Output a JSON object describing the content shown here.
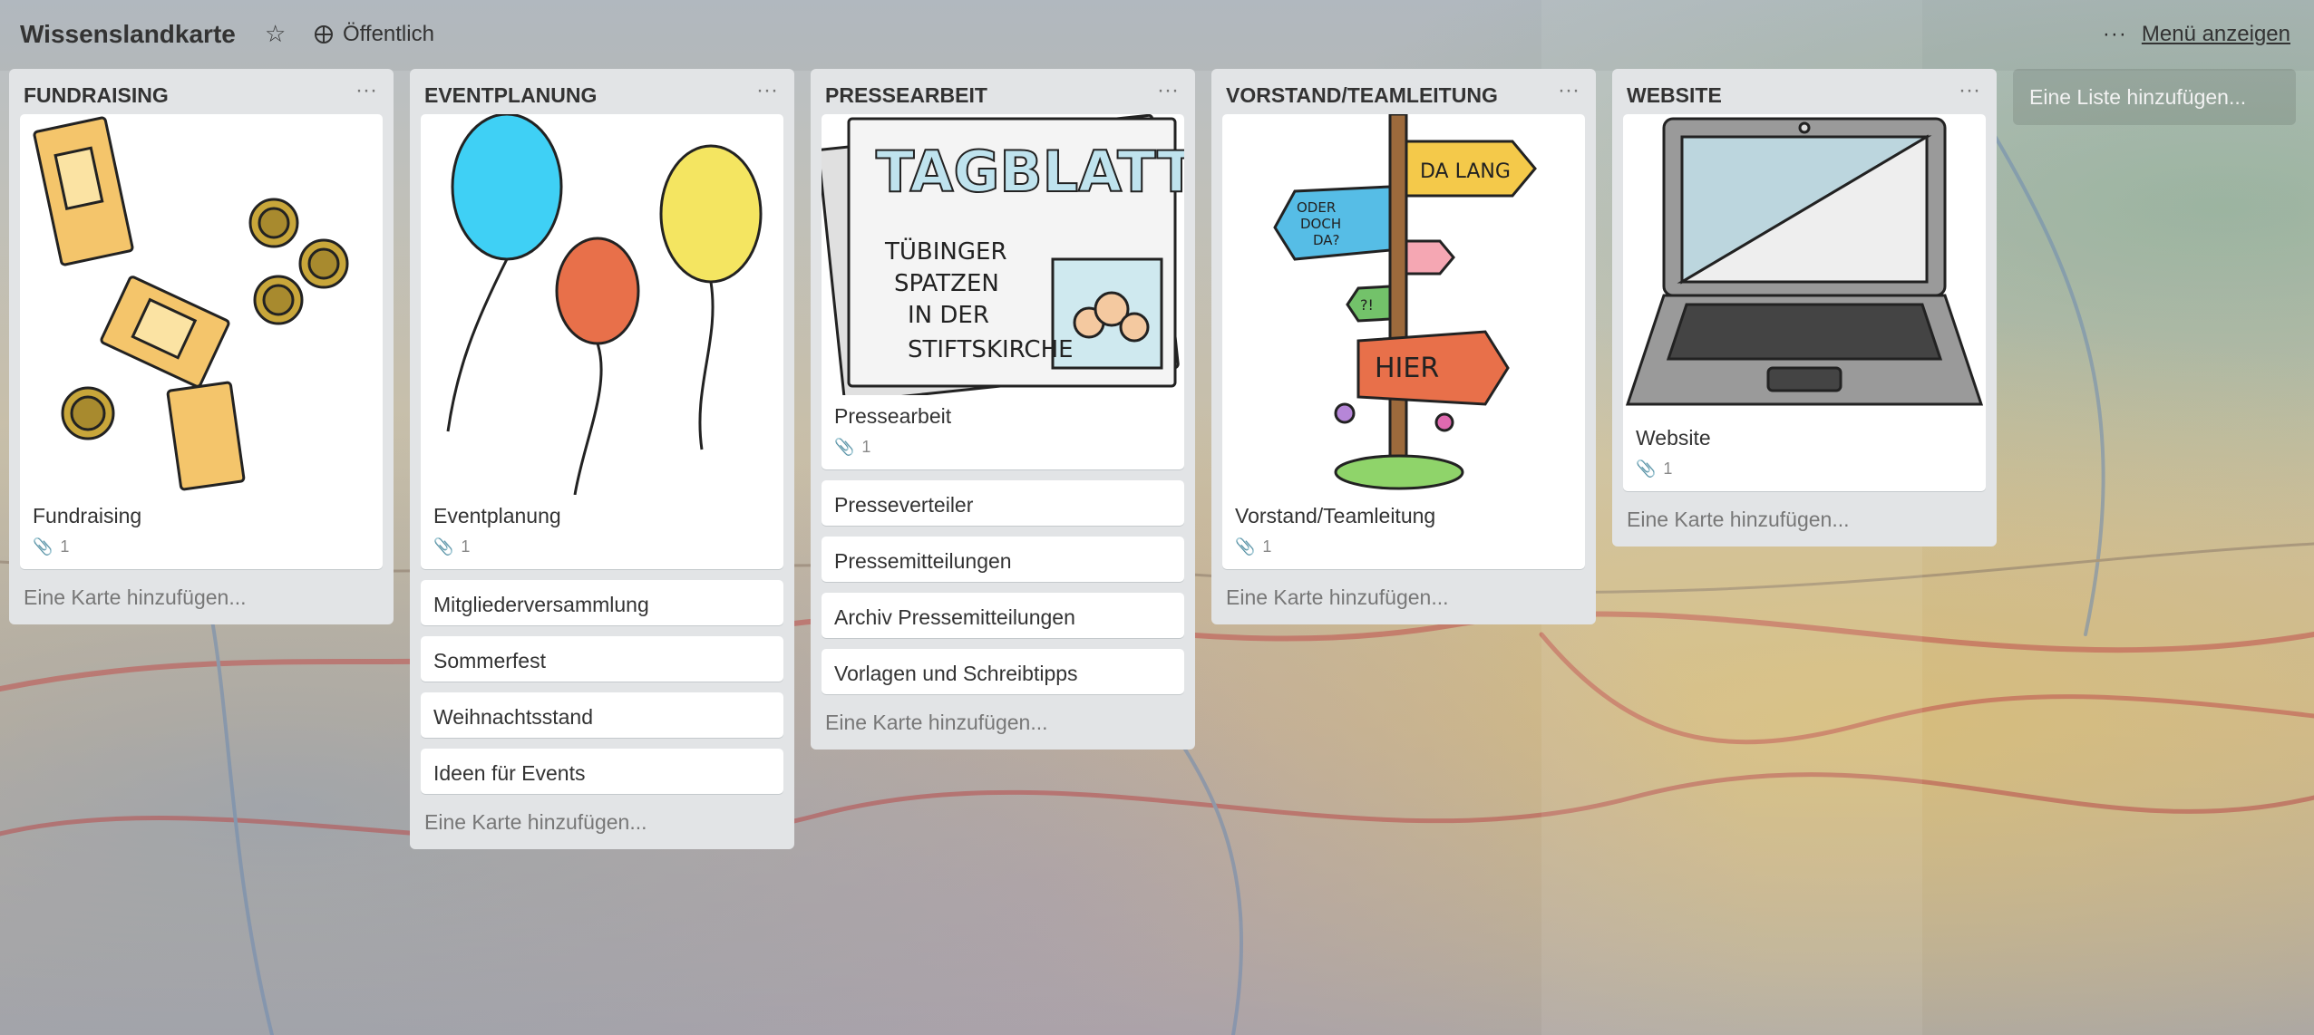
{
  "board": {
    "title": "Wissenslandkarte",
    "visibility": "Öffentlich",
    "menu_label": "Menü anzeigen"
  },
  "icons": {
    "star": "star-icon",
    "globe": "globe-icon",
    "more": "more-dots-icon",
    "attachment": "paperclip-icon"
  },
  "lists": [
    {
      "title": "FUNDRAISING",
      "cover_card": {
        "title": "Fundraising",
        "attachments": "1"
      },
      "cards": [],
      "add_card": "Eine Karte hinzufügen..."
    },
    {
      "title": "EVENTPLANUNG",
      "cover_card": {
        "title": "Eventplanung",
        "attachments": "1"
      },
      "cards": [
        "Mitgliederversammlung",
        "Sommerfest",
        "Weihnachtsstand",
        "Ideen für Events"
      ],
      "add_card": "Eine Karte hinzufügen..."
    },
    {
      "title": "PRESSEARBEIT",
      "cover_card": {
        "title": "Pressearbeit",
        "attachments": "1",
        "art_title": "TAGBLATT",
        "art_lines": [
          "TÜBINGER",
          "SPATZEN",
          "IN DER",
          "STIFTSKIRCHE"
        ]
      },
      "cards": [
        "Presseverteiler",
        "Pressemitteilungen",
        "Archiv Pressemitteilungen",
        "Vorlagen und Schreibtipps"
      ],
      "add_card": "Eine Karte hinzufügen..."
    },
    {
      "title": "VORSTAND/TEAMLEITUNG",
      "cover_card": {
        "title": "Vorstand/Teamleitung",
        "attachments": "1",
        "art_signs": [
          "DA LANG",
          "ODER",
          "DOCH",
          "DA?",
          "?!",
          "HIER"
        ]
      },
      "cards": [],
      "add_card": "Eine Karte hinzufügen..."
    },
    {
      "title": "WEBSITE",
      "cover_card": {
        "title": "Website",
        "attachments": "1"
      },
      "cards": [],
      "add_card": "Eine Karte hinzufügen..."
    }
  ],
  "add_list": "Eine Liste hinzufügen...",
  "colors": {
    "list_bg": "#e2e4e6",
    "card_bg": "#ffffff",
    "text": "#333333",
    "muted": "#777777"
  }
}
